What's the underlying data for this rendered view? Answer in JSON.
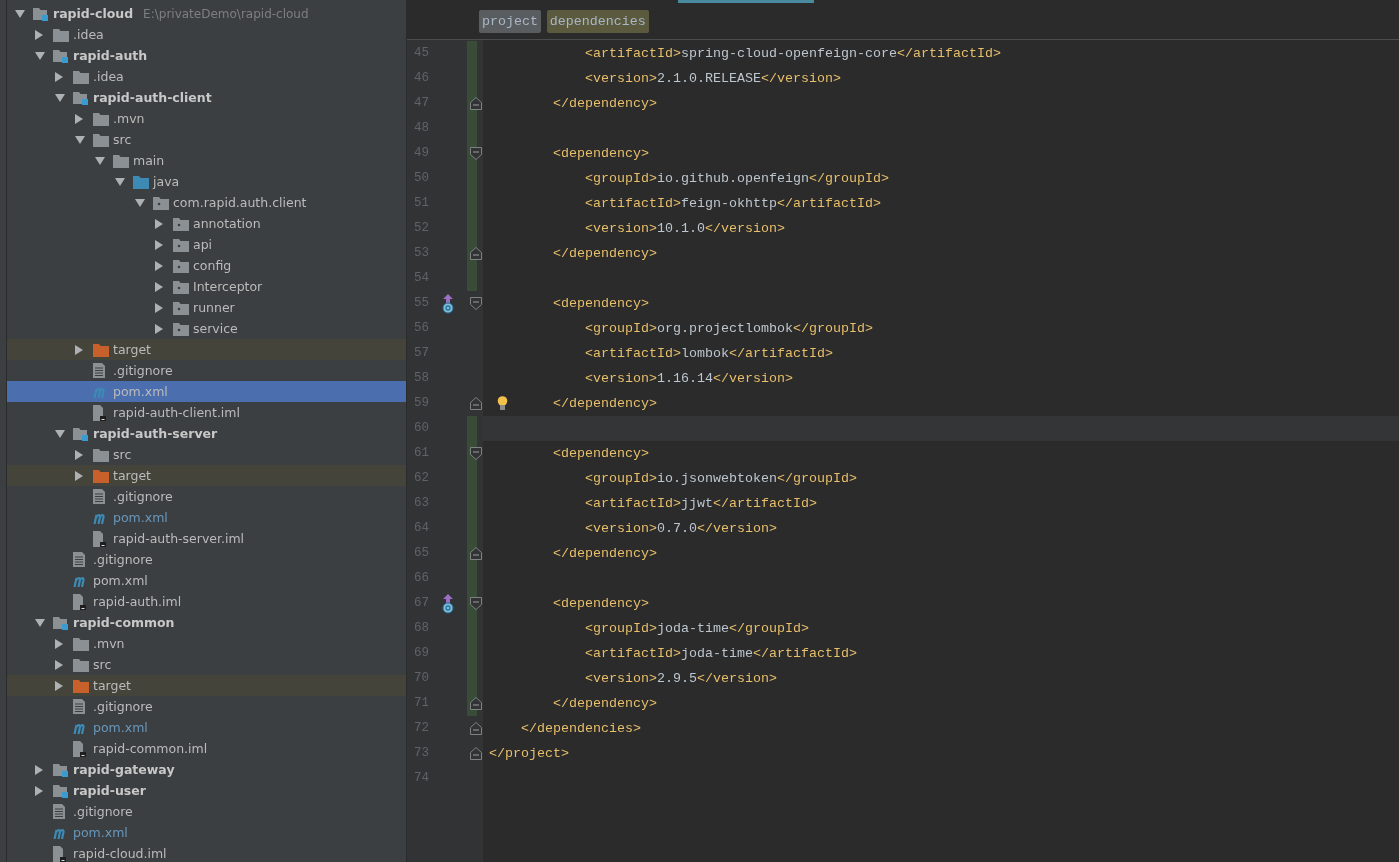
{
  "project_tree": [
    {
      "label": "rapid-cloud",
      "kind": "module",
      "path": "E:\\privateDemo\\rapid-cloud",
      "expanded": true,
      "selected": false,
      "children": [
        {
          "label": ".idea",
          "kind": "folder",
          "expanded": false,
          "selected": false
        },
        {
          "label": "rapid-auth",
          "kind": "module",
          "expanded": true,
          "selected": false,
          "children": [
            {
              "label": ".idea",
              "kind": "folder",
              "expanded": false,
              "selected": false
            },
            {
              "label": "rapid-auth-client",
              "kind": "module",
              "expanded": true,
              "selected": false,
              "children": [
                {
                  "label": ".mvn",
                  "kind": "folder",
                  "expanded": false,
                  "selected": false
                },
                {
                  "label": "src",
                  "kind": "folder",
                  "expanded": true,
                  "selected": false,
                  "children": [
                    {
                      "label": "main",
                      "kind": "folder",
                      "expanded": true,
                      "selected": false,
                      "children": [
                        {
                          "label": "java",
                          "kind": "source",
                          "expanded": true,
                          "selected": false,
                          "children": [
                            {
                              "label": "com.rapid.auth.client",
                              "kind": "package",
                              "expanded": true,
                              "selected": false,
                              "children": [
                                {
                                  "label": "annotation",
                                  "kind": "package",
                                  "expanded": false,
                                  "selected": false
                                },
                                {
                                  "label": "api",
                                  "kind": "package",
                                  "expanded": false,
                                  "selected": false
                                },
                                {
                                  "label": "config",
                                  "kind": "package",
                                  "expanded": false,
                                  "selected": false
                                },
                                {
                                  "label": "Interceptor",
                                  "kind": "package",
                                  "expanded": false,
                                  "selected": false
                                },
                                {
                                  "label": "runner",
                                  "kind": "package",
                                  "expanded": false,
                                  "selected": false
                                },
                                {
                                  "label": "service",
                                  "kind": "package",
                                  "expanded": false,
                                  "selected": false
                                }
                              ]
                            }
                          ]
                        }
                      ]
                    }
                  ]
                },
                {
                  "label": "target",
                  "kind": "excluded",
                  "expanded": false,
                  "selected": false
                },
                {
                  "label": ".gitignore",
                  "kind": "text",
                  "changed": false,
                  "selected": false
                },
                {
                  "label": "pom.xml",
                  "kind": "pom",
                  "changed": false,
                  "selected": true
                },
                {
                  "label": "rapid-auth-client.iml",
                  "kind": "iml",
                  "changed": false,
                  "selected": false
                }
              ]
            },
            {
              "label": "rapid-auth-server",
              "kind": "module",
              "expanded": true,
              "selected": false,
              "children": [
                {
                  "label": "src",
                  "kind": "folder",
                  "expanded": false,
                  "selected": false
                },
                {
                  "label": "target",
                  "kind": "excluded",
                  "expanded": false,
                  "selected": false
                },
                {
                  "label": ".gitignore",
                  "kind": "text",
                  "changed": false,
                  "selected": false
                },
                {
                  "label": "pom.xml",
                  "kind": "pom",
                  "changed": true,
                  "selected": false
                },
                {
                  "label": "rapid-auth-server.iml",
                  "kind": "iml",
                  "changed": false,
                  "selected": false
                }
              ]
            },
            {
              "label": ".gitignore",
              "kind": "text",
              "changed": false,
              "selected": false
            },
            {
              "label": "pom.xml",
              "kind": "pom",
              "changed": false,
              "selected": false
            },
            {
              "label": "rapid-auth.iml",
              "kind": "iml",
              "changed": false,
              "selected": false
            }
          ]
        },
        {
          "label": "rapid-common",
          "kind": "module",
          "expanded": true,
          "selected": false,
          "children": [
            {
              "label": ".mvn",
              "kind": "folder",
              "expanded": false,
              "selected": false
            },
            {
              "label": "src",
              "kind": "folder",
              "expanded": false,
              "selected": false
            },
            {
              "label": "target",
              "kind": "excluded",
              "expanded": false,
              "selected": false
            },
            {
              "label": ".gitignore",
              "kind": "text",
              "changed": false,
              "selected": false
            },
            {
              "label": "pom.xml",
              "kind": "pom",
              "changed": true,
              "selected": false
            },
            {
              "label": "rapid-common.iml",
              "kind": "iml",
              "changed": false,
              "selected": false
            }
          ]
        },
        {
          "label": "rapid-gateway",
          "kind": "module",
          "expanded": false,
          "selected": false
        },
        {
          "label": "rapid-user",
          "kind": "module",
          "expanded": false,
          "selected": false
        },
        {
          "label": ".gitignore",
          "kind": "text",
          "changed": false,
          "selected": false
        },
        {
          "label": "pom.xml",
          "kind": "pom",
          "changed": true,
          "selected": false
        },
        {
          "label": "rapid-cloud.iml",
          "kind": "iml",
          "changed": false,
          "selected": false
        }
      ]
    }
  ],
  "breadcrumbs": [
    {
      "label": "project",
      "selected": false
    },
    {
      "label": "dependencies",
      "selected": true
    }
  ],
  "editor_lines": [
    {
      "number": "45",
      "code": "            <artifactId>spring-cloud-openfeign-core</artifactId>",
      "changed": true,
      "current": false
    },
    {
      "number": "46",
      "code": "            <version>2.1.0.RELEASE</version>",
      "changed": true,
      "current": false
    },
    {
      "number": "47",
      "code": "        </dependency>",
      "fold": {
        "kind": "end"
      },
      "changed": true,
      "current": false
    },
    {
      "number": "48",
      "changed": true,
      "current": false
    },
    {
      "number": "49",
      "code": "        <dependency>",
      "fold": {
        "kind": "start"
      },
      "changed": true,
      "current": false
    },
    {
      "number": "50",
      "code": "            <groupId>io.github.openfeign</groupId>",
      "changed": true,
      "current": false
    },
    {
      "number": "51",
      "code": "            <artifactId>feign-okhttp</artifactId>",
      "changed": true,
      "current": false
    },
    {
      "number": "52",
      "code": "            <version>10.1.0</version>",
      "changed": true,
      "current": false
    },
    {
      "number": "53",
      "code": "        </dependency>",
      "fold": {
        "kind": "end"
      },
      "changed": true,
      "current": false
    },
    {
      "number": "54",
      "changed": true,
      "current": false
    },
    {
      "number": "55",
      "code": "        <dependency>",
      "fold": {
        "kind": "start"
      },
      "marker": {
        "kind": "override"
      },
      "changed": false,
      "current": false
    },
    {
      "number": "56",
      "code": "            <groupId>org.projectlombok</groupId>",
      "changed": false,
      "current": false
    },
    {
      "number": "57",
      "code": "            <artifactId>lombok</artifactId>",
      "changed": false,
      "current": false
    },
    {
      "number": "58",
      "code": "            <version>1.16.14</version>",
      "changed": false,
      "current": false
    },
    {
      "number": "59",
      "code": "        </dependency>",
      "fold": {
        "kind": "end"
      },
      "marker": {
        "kind": "bulb"
      },
      "changed": false,
      "current": false
    },
    {
      "number": "60",
      "changed": true,
      "current": true
    },
    {
      "number": "61",
      "code": "        <dependency>",
      "fold": {
        "kind": "start"
      },
      "changed": true,
      "current": false
    },
    {
      "number": "62",
      "code": "            <groupId>io.jsonwebtoken</groupId>",
      "changed": true,
      "current": false
    },
    {
      "number": "63",
      "code": "            <artifactId>jjwt</artifactId>",
      "changed": true,
      "current": false
    },
    {
      "number": "64",
      "code": "            <version>0.7.0</version>",
      "changed": true,
      "current": false
    },
    {
      "number": "65",
      "code": "        </dependency>",
      "fold": {
        "kind": "end"
      },
      "changed": true,
      "current": false
    },
    {
      "number": "66",
      "changed": true,
      "current": false
    },
    {
      "number": "67",
      "code": "        <dependency>",
      "fold": {
        "kind": "start"
      },
      "marker": {
        "kind": "override"
      },
      "changed": true,
      "current": false
    },
    {
      "number": "68",
      "code": "            <groupId>joda-time</groupId>",
      "changed": true,
      "current": false
    },
    {
      "number": "69",
      "code": "            <artifactId>joda-time</artifactId>",
      "changed": true,
      "current": false
    },
    {
      "number": "70",
      "code": "            <version>2.9.5</version>",
      "changed": true,
      "current": false
    },
    {
      "number": "71",
      "code": "        </dependency>",
      "fold": {
        "kind": "end"
      },
      "changed": true,
      "current": false
    },
    {
      "number": "72",
      "code": "    </dependencies>",
      "fold": {
        "kind": "end"
      },
      "changed": false,
      "current": false
    },
    {
      "number": "73",
      "code": "</project>",
      "fold": {
        "kind": "end"
      },
      "changed": false,
      "current": false
    },
    {
      "number": "74",
      "changed": false,
      "current": false
    }
  ]
}
